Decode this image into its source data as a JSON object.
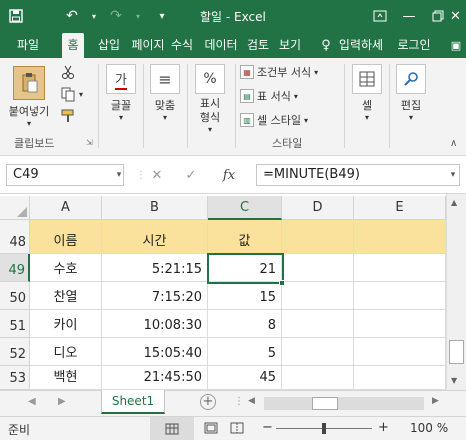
{
  "window": {
    "title": "할일 - Excel",
    "save_icon": "save-icon",
    "undo_icon": "undo-icon",
    "redo_icon": "redo-icon",
    "customize_icon": "customize-qat-icon"
  },
  "tabs": [
    "파일",
    "홈",
    "삽입",
    "페이지",
    "수식",
    "데이터",
    "검토",
    "보기"
  ],
  "active_tab": "홈",
  "tell_me": "입력하세",
  "login": "로그인",
  "ribbon": {
    "clipboard": {
      "paste_label": "붙여넣기",
      "group_label": "클립보드"
    },
    "font": {
      "label": "글꼴",
      "glyph": "가"
    },
    "alignment": {
      "label": "맞춤",
      "glyph": "≡"
    },
    "number": {
      "label": "표시 형식",
      "glyph": "%"
    },
    "styles": {
      "conditional": "조건부 서식",
      "table": "표 서식",
      "cell_style": "셀 스타일",
      "group_label": "스타일"
    },
    "cells": {
      "label": "셀"
    },
    "editing": {
      "label": "편집"
    }
  },
  "formula_bar": {
    "name_box": "C49",
    "formula": "=MINUTE(B49)"
  },
  "grid": {
    "columns": [
      "A",
      "B",
      "C",
      "D",
      "E"
    ],
    "selected_column": "C",
    "rows": [
      "48",
      "49",
      "50",
      "51",
      "52",
      "53"
    ],
    "selected_row": "49",
    "header_row": {
      "A": "이름",
      "B": "시간",
      "C": "값"
    },
    "data": [
      {
        "A": "수호",
        "B": "5:21:15",
        "C": "21"
      },
      {
        "A": "찬열",
        "B": "7:15:20",
        "C": "15"
      },
      {
        "A": "카이",
        "B": "10:08:30",
        "C": "8"
      },
      {
        "A": "디오",
        "B": "15:05:40",
        "C": "5"
      },
      {
        "A": "백현",
        "B": "21:45:50",
        "C": "45"
      }
    ]
  },
  "sheets": [
    "Sheet1"
  ],
  "status": {
    "mode": "준비",
    "zoom": "100 %"
  },
  "colors": {
    "accent": "#217346",
    "header_fill": "#fbe29c"
  }
}
